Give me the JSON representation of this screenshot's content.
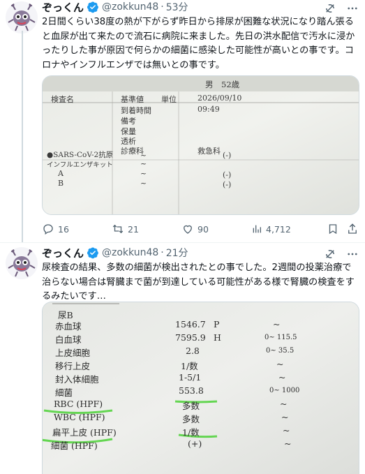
{
  "posts": [
    {
      "author": {
        "name": "ぞっくん",
        "handle": "@zokkun48",
        "time": "53分"
      },
      "text": "2日間くらい38度の熱が下がらず昨日から排尿が困難な状況になり踏ん張ると血尿が出て来たので流石に病院に来ました。先日の洪水配信で汚水に浸かったりした事が原因で何らかの細菌に感染した可能性が高いとの事です。コロナやインフルエンザでは無いとの事です。",
      "image": {
        "header_text": "男　52歳",
        "col_test": "検査名",
        "col_ref": "基準値",
        "col_unit": "単位",
        "date": "2026/09/10",
        "arrival_label": "到着時間",
        "arrival_time": "09:49",
        "note_label": "備考",
        "rows_left": [
          "保量",
          "透析",
          "診療科"
        ],
        "dept": "救急科",
        "sars": "●SARS-CoV-2抗原",
        "influenza": "インフルエンザキット",
        "flu_a": "A",
        "flu_b": "B",
        "tilde": "~",
        "neg": "(-)"
      },
      "actions": {
        "replies": "16",
        "reposts": "21",
        "likes": "90",
        "views": "4,712"
      }
    },
    {
      "author": {
        "name": "ぞっくん",
        "handle": "@zokkun48",
        "time": "21分"
      },
      "text": "尿検査の結果、多数の細菌が検出されたとの事でした。2週間の投薬治療で治らない場合は腎臓まで菌が到達している可能性がある様で腎臓の検査をするみたいです…",
      "image": {
        "section": "尿B",
        "rows": [
          {
            "name": "赤血球",
            "value": "1546.7",
            "flag": "P",
            "ref": "~"
          },
          {
            "name": "白血球",
            "value": "7595.9",
            "flag": "H",
            "ref": "0~ 115.5"
          },
          {
            "name": "上皮細胞",
            "value": "2.8",
            "flag": "",
            "ref": "0~ 35.5"
          },
          {
            "name": "移行上皮",
            "value": "1/数",
            "flag": "",
            "ref": "~"
          },
          {
            "name": "封入体細胞",
            "value": "1-5/1",
            "flag": "",
            "ref": "~"
          },
          {
            "name": "細菌",
            "value": "553.8",
            "flag": "",
            "ref": "0~ 1000"
          },
          {
            "name": "RBC (HPF)",
            "value": "多数",
            "flag": "",
            "ref": "~"
          },
          {
            "name": "WBC (HPF)",
            "value": "多数",
            "flag": "",
            "ref": "~"
          },
          {
            "name": "扁平上皮 (HPF)",
            "value": "1/数",
            "flag": "",
            "ref": "~"
          },
          {
            "name": "細菌 (HPF)",
            "value": "(+)",
            "flag": "",
            "ref": "~"
          }
        ]
      }
    }
  ],
  "colors": {
    "text": "#0f1419",
    "muted": "#536471",
    "verified": "#1d9bf0",
    "highlight": "#4cd137"
  }
}
